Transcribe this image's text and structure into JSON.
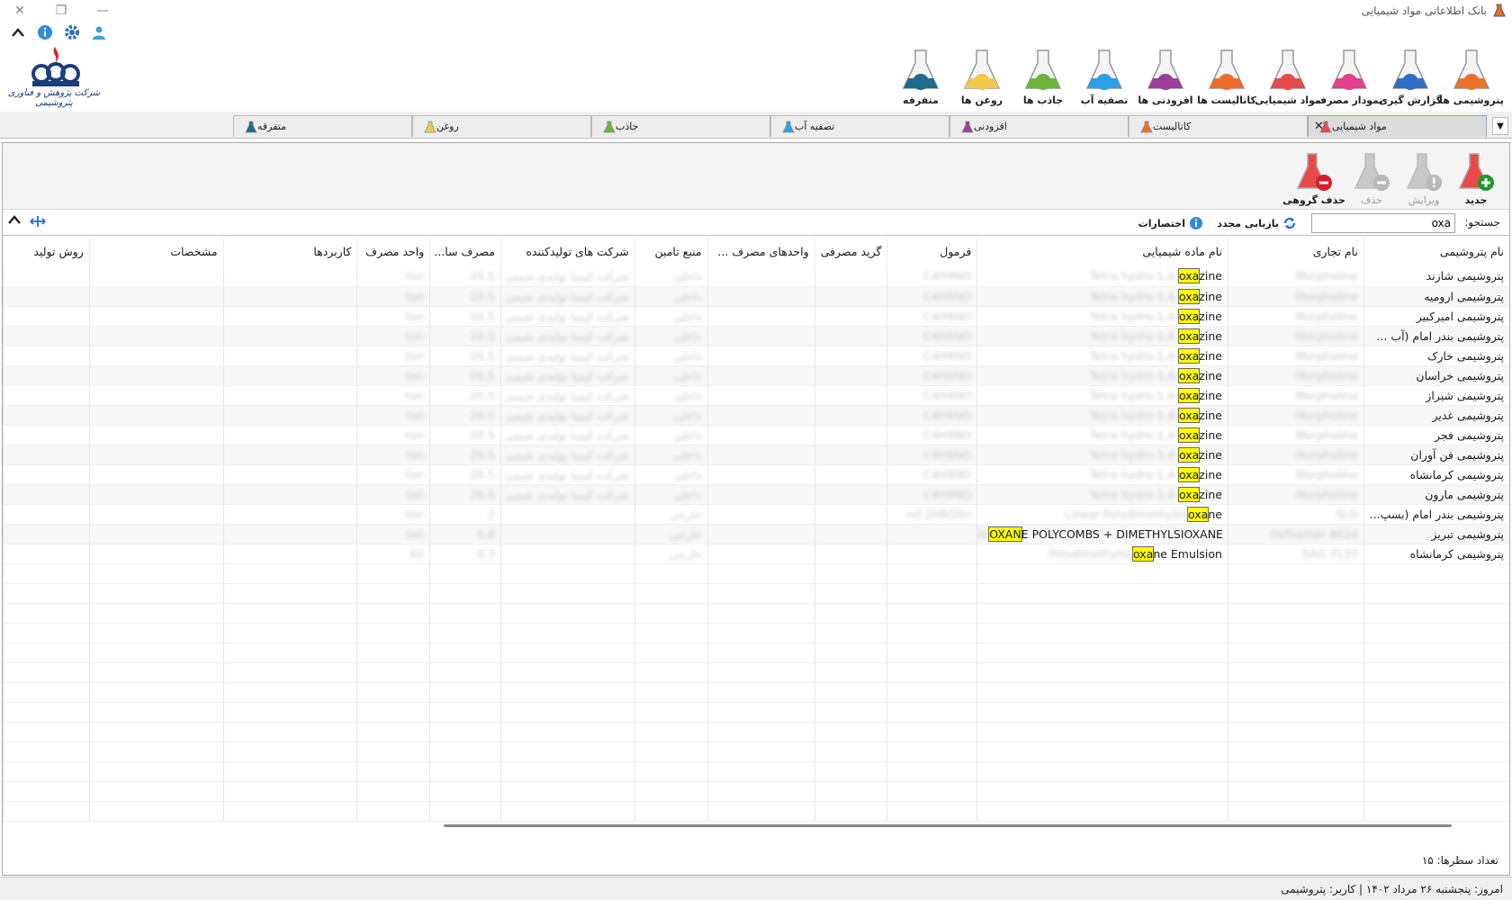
{
  "app": {
    "title": "بانک اطلاعاتی مواد شیمیایی"
  },
  "logo": {
    "text": "شرکت پژوهش و فناوری پتروشیمی"
  },
  "ribbon": [
    {
      "label": "پتروشیمی ها",
      "color": "#e8742b"
    },
    {
      "label": "گزارش گیری",
      "color": "#2f6fc8"
    },
    {
      "label": "نمودار مصرف",
      "color": "#e23f8c"
    },
    {
      "label": "مواد شیمیایی",
      "color": "#e84a4a"
    },
    {
      "label": "کاتالیست ها",
      "color": "#f06c2a"
    },
    {
      "label": "افزودنی ها",
      "color": "#9b3f9b"
    },
    {
      "label": "تصفیه آب",
      "color": "#2aa0e8"
    },
    {
      "label": "جاذب ها",
      "color": "#6cb43c"
    },
    {
      "label": "روغن ها",
      "color": "#f2c84a"
    },
    {
      "label": "متفرقه",
      "color": "#1e6c8c"
    }
  ],
  "tabs": [
    {
      "label": "مواد شیمیایی",
      "active": true
    },
    {
      "label": "کاتالیست",
      "active": false
    },
    {
      "label": "افزودنی",
      "active": false
    },
    {
      "label": "تصفیه آب",
      "active": false
    },
    {
      "label": "جاذب",
      "active": false
    },
    {
      "label": "روغن",
      "active": false
    },
    {
      "label": "متفرقه",
      "active": false
    }
  ],
  "toolbar": {
    "new_label": "جدید",
    "edit_label": "ویرایش",
    "delete_label": "حذف",
    "group_delete_label": "حذف گروهی"
  },
  "search": {
    "label": "جستجو:",
    "value": "oxa",
    "reload_label": "بازیابی مجدد",
    "shortcuts_label": "اختصارات"
  },
  "grid": {
    "columns": [
      "نام پتروشیمی",
      "نام تجاری",
      "نام ماده شیمیایی",
      "فرمول",
      "گرید مصرفی",
      "واحدهای مصرف ...",
      "منبع تامین",
      "شرکت های تولیدکننده",
      "مصرف سا...",
      "واحد مصرف",
      "کاربردها",
      "مشخصات",
      "روش تولید"
    ],
    "rows": [
      {
        "petro": "پتروشیمی شازند",
        "trade": "Morpholine",
        "chem_pre": "Tetra hydro 1,4-",
        "chem_hl": "oxa",
        "chem_post": "zine",
        "formula": "C4H9NO",
        "supply": "داخلی",
        "producer": "شرکت کیمیا تولیدی شیمی",
        "annual": "20.5",
        "unit": "ton"
      },
      {
        "petro": "پتروشیمی ارومیه",
        "trade": "Morpholine",
        "chem_pre": "Tetra hydro 1,4-",
        "chem_hl": "oxa",
        "chem_post": "zine",
        "formula": "C4H9NO",
        "supply": "داخلی",
        "producer": "شرکت کیمیا تولیدی شیمی",
        "annual": "20.5",
        "unit": "ton"
      },
      {
        "petro": "پتروشیمی امیرکبیر",
        "trade": "Morpholine",
        "chem_pre": "Tetra hydro 1,4-",
        "chem_hl": "oxa",
        "chem_post": "zine",
        "formula": "C4H9NO",
        "supply": "داخلی",
        "producer": "شرکت کیمیا تولیدی شیمی",
        "annual": "20.5",
        "unit": "ton"
      },
      {
        "petro": "پتروشیمی بندر امام (آب ...",
        "trade": "Morpholine",
        "chem_pre": "Tetra hydro 1,4-",
        "chem_hl": "oxa",
        "chem_post": "zine",
        "formula": "C4H9NO",
        "supply": "داخلی",
        "producer": "شرکت کیمیا تولیدی شیمی",
        "annual": "20.5",
        "unit": "ton"
      },
      {
        "petro": "پتروشیمی خارک",
        "trade": "Morpholine",
        "chem_pre": "Tetra hydro 1,4-",
        "chem_hl": "oxa",
        "chem_post": "zine",
        "formula": "C4H9NO",
        "supply": "داخلی",
        "producer": "شرکت کیمیا تولیدی شیمی",
        "annual": "20.5",
        "unit": "ton"
      },
      {
        "petro": "پتروشیمی خراسان",
        "trade": "Morpholine",
        "chem_pre": "Tetra hydro 1,4-",
        "chem_hl": "oxa",
        "chem_post": "zine",
        "formula": "C4H9NO",
        "supply": "داخلی",
        "producer": "شرکت کیمیا تولیدی شیمی",
        "annual": "20.5",
        "unit": "ton"
      },
      {
        "petro": "پتروشیمی شیراز",
        "trade": "Morpholine",
        "chem_pre": "Tetra hydro 1,4-",
        "chem_hl": "oxa",
        "chem_post": "zine",
        "formula": "C4H9NO",
        "supply": "داخلی",
        "producer": "شرکت کیمیا تولیدی شیمی",
        "annual": "20.5",
        "unit": "ton"
      },
      {
        "petro": "پتروشیمی غدیر",
        "trade": "Morpholine",
        "chem_pre": "Tetra hydro 1,4-",
        "chem_hl": "oxa",
        "chem_post": "zine",
        "formula": "C4H9NO",
        "supply": "داخلی",
        "producer": "شرکت کیمیا تولیدی شیمی",
        "annual": "20.5",
        "unit": "ton"
      },
      {
        "petro": "پتروشیمی فجر",
        "trade": "Morpholine",
        "chem_pre": "Tetra hydro 1,4-",
        "chem_hl": "oxa",
        "chem_post": "zine",
        "formula": "C4H9NO",
        "supply": "داخلی",
        "producer": "شرکت کیمیا تولیدی شیمی",
        "annual": "20.5",
        "unit": "ton"
      },
      {
        "petro": "پتروشیمی فن آوران",
        "trade": "Morpholine",
        "chem_pre": "Tetra hydro 1,4-",
        "chem_hl": "oxa",
        "chem_post": "zine",
        "formula": "C4H9NO",
        "supply": "داخلی",
        "producer": "شرکت کیمیا تولیدی شیمی",
        "annual": "20.5",
        "unit": "ton"
      },
      {
        "petro": "پتروشیمی کرمانشاه",
        "trade": "Morpholine",
        "chem_pre": "Tetra hydro 1,4-",
        "chem_hl": "oxa",
        "chem_post": "zine",
        "formula": "C4H9NO",
        "supply": "داخلی",
        "producer": "شرکت کیمیا تولیدی شیمی",
        "annual": "20.5",
        "unit": "ton"
      },
      {
        "petro": "پتروشیمی مارون",
        "trade": "Morpholine",
        "chem_pre": "Tetra hydro 1,4-",
        "chem_hl": "oxa",
        "chem_post": "zine",
        "formula": "C4H9NO",
        "supply": "داخلی",
        "producer": "شرکت کیمیا تولیدی شیمی",
        "annual": "20.5",
        "unit": "ton"
      },
      {
        "petro": "پتروشیمی بندر امام (بسپ...",
        "trade": "SLD",
        "chem_pre": "Linear Polydimethylsil",
        "chem_hl": "oxa",
        "chem_post": "ne",
        "formula": "(C2H6OSi)n",
        "supply": "خارجی",
        "producer": "",
        "annual": "2",
        "unit": "ton"
      },
      {
        "petro": "پتروشیمی تبریز",
        "trade": "Defoamer 8024",
        "chem_pre": "SIL",
        "chem_hl": "OXAN",
        "chem_post": "E POLYCOMBS + DIMETHYLSIOXANE",
        "formula": "",
        "supply": "خارجی",
        "producer": "",
        "annual": "5.8",
        "unit": "ton"
      },
      {
        "petro": "پتروشیمی کرمانشاه",
        "trade": "SAG 7133",
        "chem_pre": "Polydimethylsil",
        "chem_hl": "oxa",
        "chem_post": "ne Emulsion",
        "formula": "",
        "supply": "خارجی",
        "producer": "",
        "annual": "0.3",
        "unit": "kit"
      }
    ]
  },
  "footer": {
    "row_count": "تعداد سطرها: ۱۵",
    "status": "امروز: پنجشنبه ۲۶ مرداد ۱۴۰۲   |   کاربر: پتروشیمی"
  }
}
